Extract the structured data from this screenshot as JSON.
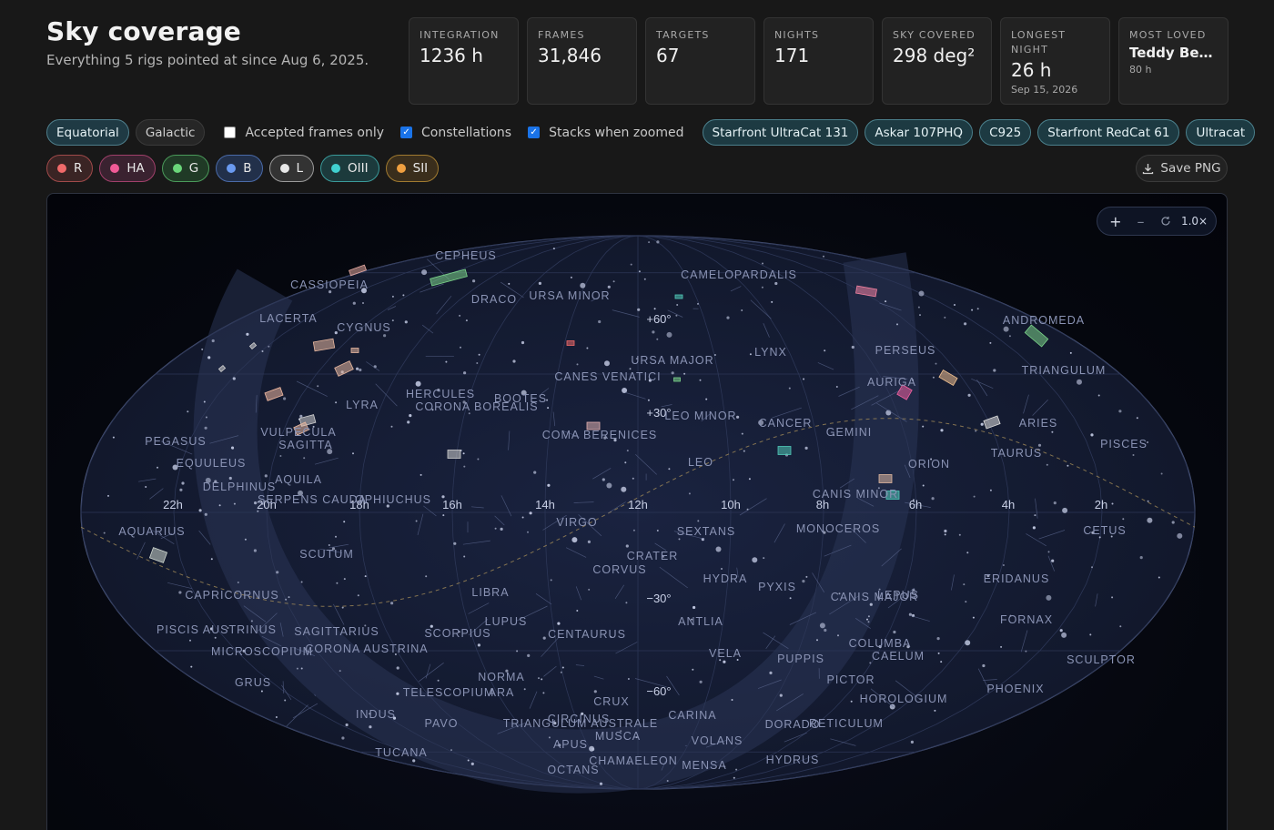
{
  "header": {
    "title": "Sky coverage",
    "subtitle": "Everything 5 rigs pointed at since Aug 6, 2025."
  },
  "stats": [
    {
      "label": "INTEGRATION",
      "value": "1236 h",
      "sub": ""
    },
    {
      "label": "FRAMES",
      "value": "31,846",
      "sub": ""
    },
    {
      "label": "TARGETS",
      "value": "67",
      "sub": ""
    },
    {
      "label": "NIGHTS",
      "value": "171",
      "sub": ""
    },
    {
      "label": "SKY COVERED",
      "value": "298 deg²",
      "sub": ""
    },
    {
      "label": "LONGEST NIGHT",
      "value": "26 h",
      "sub": "Sep 15, 2026"
    },
    {
      "label": "MOST LOVED",
      "value": "Teddy Bea...",
      "sub": "80 h"
    }
  ],
  "toolbar": {
    "modes": [
      {
        "label": "Equatorial",
        "active": true
      },
      {
        "label": "Galactic",
        "active": false
      }
    ],
    "checks": [
      {
        "label": "Accepted frames only",
        "checked": false
      },
      {
        "label": "Constellations",
        "checked": true
      },
      {
        "label": "Stacks when zoomed",
        "checked": true
      }
    ],
    "rigs": [
      "Starfront UltraCat 131",
      "Askar 107PHQ",
      "C925",
      "Starfront RedCat 61",
      "Ultracat"
    ]
  },
  "filters": [
    {
      "label": "R",
      "color": "#f06a6a",
      "bg": "#3a2424",
      "border": "#a04a4a"
    },
    {
      "label": "HA",
      "color": "#f05a96",
      "bg": "#3a2230",
      "border": "#a0406a"
    },
    {
      "label": "G",
      "color": "#6ad67a",
      "bg": "#203a26",
      "border": "#4a9a5a"
    },
    {
      "label": "B",
      "color": "#6a9af0",
      "bg": "#22304a",
      "border": "#4a6aa8"
    },
    {
      "label": "L",
      "color": "#e8e8e8",
      "bg": "#333",
      "border": "#9a9a9a"
    },
    {
      "label": "OIII",
      "color": "#40d0d0",
      "bg": "#1c3a3c",
      "border": "#3a9a9a"
    },
    {
      "label": "SII",
      "color": "#f0a040",
      "bg": "#3a2e1c",
      "border": "#a07a30"
    }
  ],
  "save_label": "Save PNG",
  "zoom": {
    "plus": "+",
    "minus": "–",
    "level": "1.0×"
  },
  "map": {
    "ra_labels": [
      "22h",
      "20h",
      "18h",
      "16h",
      "14h",
      "12h",
      "10h",
      "8h",
      "6h",
      "4h",
      "2h"
    ],
    "dec_labels": [
      "+60°",
      "+30°",
      "−30°",
      "−60°"
    ],
    "constellations": [
      "CEPHEUS",
      "CASSIOPEIA",
      "DRACO",
      "URSA MINOR",
      "CAMELOPARDALIS",
      "LACERTA",
      "CYGNUS",
      "ANDROMEDA",
      "PERSEUS",
      "LYNX",
      "URSA MAJOR",
      "CANES VENATICI",
      "TRIANGULUM",
      "AURIGA",
      "HERCULES",
      "BOOTES",
      "CORONA BOREALIS",
      "LYRA",
      "LEO MINOR",
      "CANCER",
      "GEMINI",
      "ARIES",
      "COMA BERENICES",
      "VULPECULA",
      "SAGITTA",
      "PEGASUS",
      "TAURUS",
      "PISCES",
      "EQUULEUS",
      "LEO",
      "ORION",
      "DELPHINUS",
      "AQUILA",
      "SERPENS CAUDA",
      "OPHIUCHUS",
      "CANIS MINOR",
      "VIRGO",
      "SEXTANS",
      "MONOCEROS",
      "AQUARIUS",
      "CETUS",
      "SCUTUM",
      "CRATER",
      "CORVUS",
      "HYDRA",
      "PYXIS",
      "ERIDANUS",
      "CAPRICORNUS",
      "LIBRA",
      "CANIS MAJOR",
      "LEPUS",
      "LUPUS",
      "ANTLIA",
      "FORNAX",
      "PISCIS AUSTRINUS",
      "SAGITTARIUS",
      "SCORPIUS",
      "CENTAURUS",
      "COLUMBA",
      "MICROSCOPIUM",
      "CORONA AUSTRINA",
      "VELA",
      "PUPPIS",
      "CAELUM",
      "SCULPTOR",
      "GRUS",
      "NORMA",
      "PICTOR",
      "PHOENIX",
      "TELESCOPIUM",
      "ARA",
      "CRUX",
      "HOROLOGIUM",
      "INDUS",
      "CIRCINUS",
      "CARINA",
      "PAVO",
      "TRIANGULUM AUSTRALE",
      "DORADO",
      "RETICULUM",
      "MUSCA",
      "APUS",
      "VOLANS",
      "TUCANA",
      "CHAMAELEON",
      "MENSA",
      "HYDRUS",
      "OCTANS"
    ]
  }
}
